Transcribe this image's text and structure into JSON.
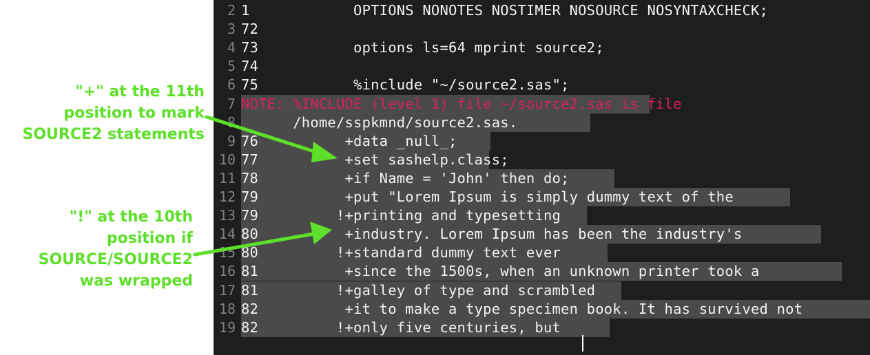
{
  "colors": {
    "editor_bg": "#1e1e1e",
    "selection_bg": "#4a4a4a",
    "note_text": "#d6215b",
    "annotation_green": "#5ee02a"
  },
  "lines": [
    {
      "ln": "2",
      "code": "1            OPTIONS NONOTES NOSTIMER NOSOURCE NOSYNTAXCHECK;",
      "note": false
    },
    {
      "ln": "3",
      "code": "72",
      "note": false
    },
    {
      "ln": "4",
      "code": "73           options ls=64 mprint source2;",
      "note": false
    },
    {
      "ln": "5",
      "code": "74",
      "note": false
    },
    {
      "ln": "6",
      "code": "75           %include \"~/source2.sas\";",
      "note": false
    },
    {
      "ln": "7",
      "code": "NOTE: %INCLUDE (level 1) file ~/source2.sas is file ",
      "note": true
    },
    {
      "ln": "8",
      "code": "      /home/sspkmnd/source2.sas.",
      "note": false
    },
    {
      "ln": "9",
      "code": "76          +data _null_;",
      "note": false
    },
    {
      "ln": "10",
      "code": "77          +set sashelp.class;",
      "note": false
    },
    {
      "ln": "11",
      "code": "78          +if Name = 'John' then do;",
      "note": false
    },
    {
      "ln": "12",
      "code": "79          +put \"Lorem Ipsum is simply dummy text of the",
      "note": false
    },
    {
      "ln": "13",
      "code": "79         !+printing and typesetting",
      "note": false
    },
    {
      "ln": "14",
      "code": "80          +industry. Lorem Ipsum has been the industry's",
      "note": false
    },
    {
      "ln": "15",
      "code": "80         !+standard dummy text ever",
      "note": false
    },
    {
      "ln": "16",
      "code": "81          +since the 1500s, when an unknown printer took a",
      "note": false
    },
    {
      "ln": "17",
      "code": "81         !+galley of type and scrambled",
      "note": false
    },
    {
      "ln": "18",
      "code": "82          +it to make a type specimen book. It has survived not",
      "note": false
    },
    {
      "ln": "19",
      "code": "82         !+only five centuries, but",
      "note": false
    }
  ],
  "annotations": {
    "plus_note": [
      "\"+\" at the 11th",
      "position to mark",
      "SOURCE2  statements"
    ],
    "bang_note": [
      "\"!\" at the 10th",
      "position if",
      "SOURCE/SOURCE2",
      "was wrapped"
    ]
  }
}
